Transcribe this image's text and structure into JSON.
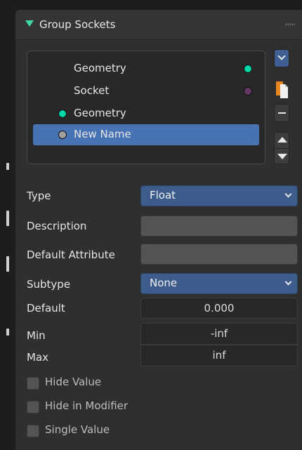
{
  "panel": {
    "title": "Group Sockets"
  },
  "sockets": [
    {
      "label": "Geometry",
      "dot_side": "right",
      "dot_color": "#00d6a3"
    },
    {
      "label": "Socket",
      "dot_side": "right",
      "dot_color": "#633863"
    },
    {
      "label": "Geometry",
      "dot_side": "left",
      "dot_color": "#00d6a3"
    },
    {
      "label": "New Name",
      "dot_side": "left",
      "dot_color": "#a1a1a1",
      "active": true
    }
  ],
  "side_buttons": [
    "chevron-down-icon",
    "paste-icon",
    "minus-icon",
    "move-up-icon",
    "move-down-icon"
  ],
  "properties": {
    "type": {
      "label": "Type",
      "value": "Float"
    },
    "description": {
      "label": "Description",
      "value": ""
    },
    "default_attribute": {
      "label": "Default Attribute",
      "value": ""
    },
    "subtype": {
      "label": "Subtype",
      "value": "None"
    },
    "default": {
      "label": "Default",
      "value": "0.000"
    },
    "min": {
      "label": "Min",
      "value": "-inf"
    },
    "max": {
      "label": "Max",
      "value": "inf"
    }
  },
  "checkboxes": [
    {
      "label": "Hide Value",
      "checked": false
    },
    {
      "label": "Hide in Modifier",
      "checked": false
    },
    {
      "label": "Single Value",
      "checked": false
    }
  ],
  "colors": {
    "accent_green": "#3fd8a0",
    "selection_blue": "#4772b3",
    "dropdown_blue": "#3d5c8c",
    "panel_bg": "#2f2f2f"
  }
}
